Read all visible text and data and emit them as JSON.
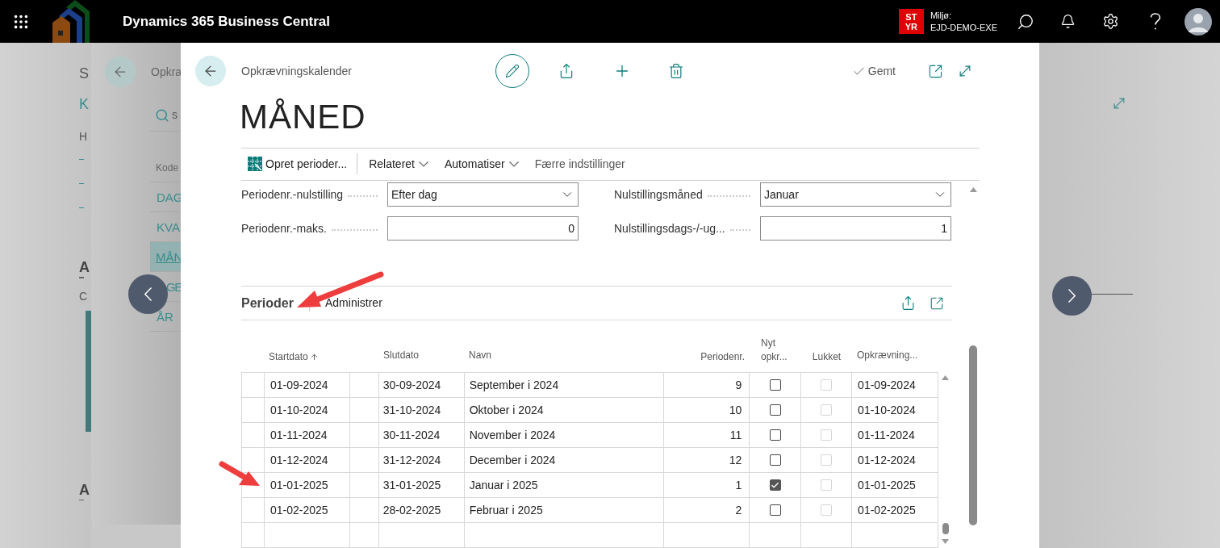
{
  "app_bar": {
    "title": "Dynamics 365 Business Central",
    "env_badge": [
      "ST",
      "YR"
    ],
    "env_label": "Miljø:",
    "env_name": "EJD-DEMO-EXE"
  },
  "background_page": {
    "fragments": [
      "S",
      "K",
      "H",
      "A",
      "C",
      "A"
    ],
    "breadcrumb": "Opkra",
    "search_text": "s",
    "column_header": "Kode",
    "rows": [
      {
        "code": "DAG",
        "selected": false
      },
      {
        "code": "KVA",
        "selected": false
      },
      {
        "code": "MÅN",
        "selected": true
      },
      {
        "code": "GE",
        "selected": false
      },
      {
        "code": "ÅR",
        "selected": false
      }
    ]
  },
  "dialog": {
    "breadcrumb": "Opkrævningskalender",
    "status": "Gemt",
    "title": "MÅNED",
    "actions": [
      {
        "label": "Opret perioder...",
        "kind": "icon"
      },
      {
        "label": "Relateret",
        "kind": "menu"
      },
      {
        "label": "Automatiser",
        "kind": "menu"
      },
      {
        "label": "Færre indstillinger",
        "kind": "plain"
      }
    ],
    "fields": [
      {
        "label": "Periodenr.-nulstilling",
        "value": "Efter dag",
        "kind": "dropdown"
      },
      {
        "label": "Nulstillingsmåned",
        "value": "Januar",
        "kind": "dropdown"
      },
      {
        "label": "Periodenr.-maks.",
        "value": "0",
        "kind": "number"
      },
      {
        "label": "Nulstillingsdags-/-ug...",
        "value": "1",
        "kind": "number"
      }
    ],
    "part": {
      "title": "Perioder",
      "action": "Administrer",
      "columns": [
        "Startdato",
        "Slutdato",
        "Navn",
        "Periodenr.",
        "Nyt opkr...",
        "Lukket",
        "Opkrævning..."
      ],
      "rows": [
        {
          "start": "01-09-2024",
          "end": "30-09-2024",
          "name": "September i 2024",
          "period": "9",
          "new": false,
          "closed": false,
          "closed_disabled": true,
          "date": "01-09-2024"
        },
        {
          "start": "01-10-2024",
          "end": "31-10-2024",
          "name": "Oktober i 2024",
          "period": "10",
          "new": false,
          "closed": false,
          "closed_disabled": true,
          "date": "01-10-2024"
        },
        {
          "start": "01-11-2024",
          "end": "30-11-2024",
          "name": "November i 2024",
          "period": "11",
          "new": false,
          "closed": false,
          "closed_disabled": true,
          "date": "01-11-2024"
        },
        {
          "start": "01-12-2024",
          "end": "31-12-2024",
          "name": "December i 2024",
          "period": "12",
          "new": false,
          "closed": false,
          "closed_disabled": true,
          "date": "01-12-2024"
        },
        {
          "start": "01-01-2025",
          "end": "31-01-2025",
          "name": "Januar i 2025",
          "period": "1",
          "new": true,
          "closed": false,
          "closed_disabled": true,
          "date": "01-01-2025"
        },
        {
          "start": "01-02-2025",
          "end": "28-02-2025",
          "name": "Februar i 2025",
          "period": "2",
          "new": false,
          "closed": false,
          "closed_disabled": true,
          "date": "01-02-2025"
        }
      ]
    }
  }
}
